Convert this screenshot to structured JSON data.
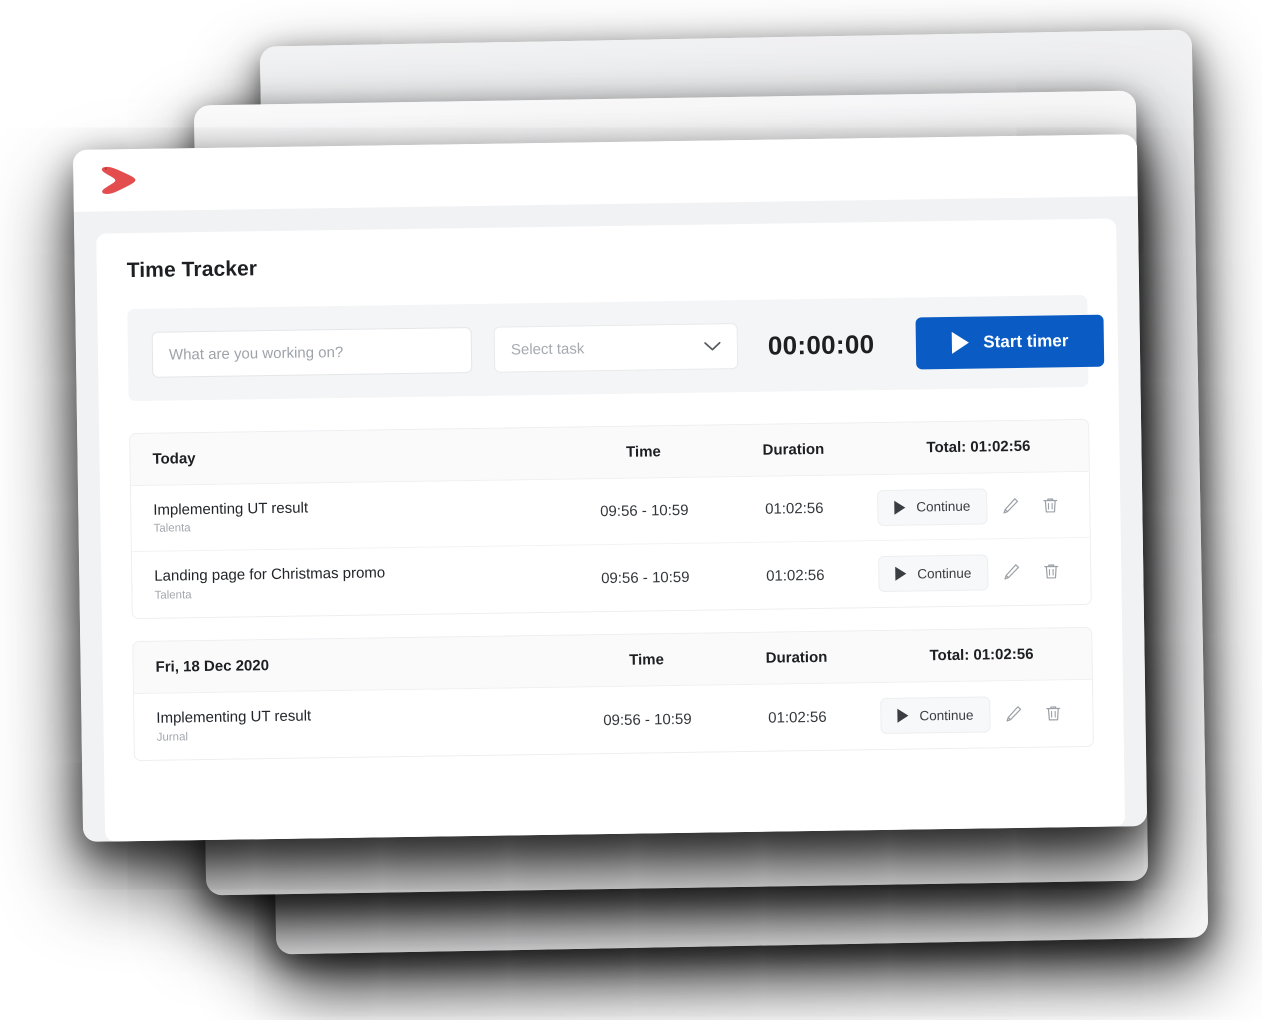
{
  "brand": {
    "logo_icon": "red-arrow-logo",
    "logo_color": "#e34d4d"
  },
  "page": {
    "title": "Time Tracker"
  },
  "timer": {
    "description_placeholder": "What are you working on?",
    "description_value": "",
    "task_select_value": "Select task",
    "task_select_icon": "chevron-down-icon",
    "elapsed": "00:00:00",
    "start_button_label": "Start timer",
    "start_button_icon": "play-icon",
    "start_button_color": "#0a5cc4"
  },
  "columns": {
    "time": "Time",
    "duration": "Duration"
  },
  "groups": [
    {
      "title": "Today",
      "time_label": "Time",
      "duration_label": "Duration",
      "total_label": "Total: 01:02:56",
      "entries": [
        {
          "title": "Implementing UT result",
          "project": "Talenta",
          "time": "09:56 - 10:59",
          "duration": "01:02:56",
          "continue_label": "Continue",
          "continue_icon": "play-icon",
          "edit_icon": "pencil-icon",
          "delete_icon": "trash-icon"
        },
        {
          "title": "Landing page for Christmas promo",
          "project": "Talenta",
          "time": "09:56 - 10:59",
          "duration": "01:02:56",
          "continue_label": "Continue",
          "continue_icon": "play-icon",
          "edit_icon": "pencil-icon",
          "delete_icon": "trash-icon"
        }
      ]
    },
    {
      "title": "Fri, 18 Dec 2020",
      "time_label": "Time",
      "duration_label": "Duration",
      "total_label": "Total: 01:02:56",
      "entries": [
        {
          "title": "Implementing UT result",
          "project": "Jurnal",
          "time": "09:56 - 10:59",
          "duration": "01:02:56",
          "continue_label": "Continue",
          "continue_icon": "play-icon",
          "edit_icon": "pencil-icon",
          "delete_icon": "trash-icon"
        }
      ]
    }
  ]
}
